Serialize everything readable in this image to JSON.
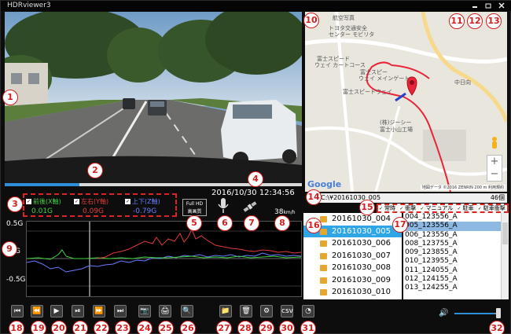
{
  "window": {
    "title": "HDRviewer3",
    "buttons": [
      "minimize",
      "restore",
      "close"
    ]
  },
  "playback": {
    "progress": 0.25
  },
  "datetime": "2016/10/30 12:34:56",
  "axes": [
    {
      "label": "前後(X軸)",
      "value": "0.01G",
      "color": "#3fd23f"
    },
    {
      "label": "左右(Y軸)",
      "value": "0.09G",
      "color": "#e23a3a"
    },
    {
      "label": "上下(Z軸)",
      "value": "-0.79G",
      "color": "#6a7cff"
    }
  ],
  "fullhd": {
    "line1": "Full HD",
    "line2": "高画質"
  },
  "speed": {
    "value": "38",
    "unit": "km/h"
  },
  "graph": {
    "ylabels": [
      "0.5G",
      "G",
      "-0.5G"
    ]
  },
  "map": {
    "labels": [
      "航空写真",
      "トヨタ交通安全",
      "センター モビリタ",
      "富士スピード",
      "ウェイ カートコース",
      "富士スピー",
      "ウェイ メインゲート",
      "富士スピードウェイ",
      "中日向",
      "(株)ジーシー",
      "富士小山工場"
    ],
    "google": "Google",
    "attribution": "地図データ ©2016 ZENRIN  200 m  利用規約",
    "zoom_in": "+",
    "zoom_out": "−"
  },
  "file_header": {
    "path": "C:\\¥20161030_005",
    "count": "46個"
  },
  "filters": [
    "常時",
    "衝撃",
    "マニュアル",
    "駐車",
    "駐車衝撃"
  ],
  "folders": [
    "20161030_004",
    "20161030_005",
    "20161030_006",
    "20161030_007",
    "20161030_008",
    "20161030_009",
    "20161030_010"
  ],
  "selected_folder": "20161030_005",
  "files": [
    "004_123556_A",
    "005_123556_A",
    "006_123556_A",
    "008_123755_A",
    "009_123855_A",
    "010_123955_A",
    "011_124055_A",
    "012_124155_A",
    "013_124255_A"
  ],
  "selected_file": "005_123556_A",
  "toolbar": {
    "icons": [
      "skip-start-icon",
      "rewind-icon",
      "play-icon",
      "step-forward-icon",
      "fast-forward-icon",
      "skip-end-icon",
      "snapshot-icon",
      "print-icon",
      "zoom-icon",
      "folder-icon",
      "delete-icon",
      "settings-icon",
      "export-csv-icon",
      "speed-gauge-icon"
    ],
    "glyphs": [
      "⏮",
      "⏪",
      "▶",
      "⏯",
      "⏩",
      "⏭",
      "📷",
      "🖨",
      "🔍",
      "📁",
      "🗑",
      "⚙",
      "csv",
      "◔"
    ]
  },
  "volume": {
    "level": 0.88
  },
  "callouts": [
    "1",
    "2",
    "3",
    "4",
    "5",
    "6",
    "7",
    "8",
    "9",
    "10",
    "11",
    "12",
    "13",
    "14",
    "15",
    "16",
    "17",
    "18",
    "19",
    "20",
    "21",
    "22",
    "23",
    "24",
    "25",
    "26",
    "27",
    "28",
    "29",
    "30",
    "31",
    "32"
  ]
}
